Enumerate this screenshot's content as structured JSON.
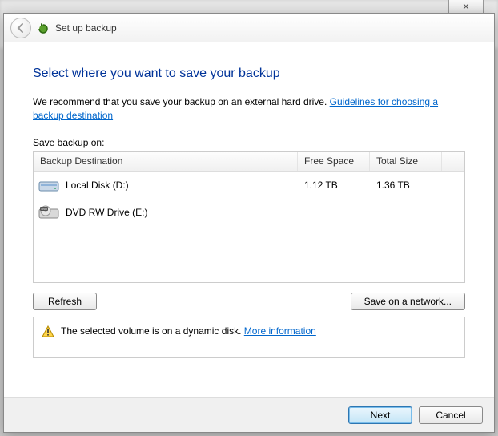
{
  "backdrop_close": "✕",
  "titlebar": {
    "back_aria": "Back",
    "title": "Set up backup"
  },
  "main": {
    "heading": "Select where you want to save your backup",
    "recommend_pre": "We recommend that you save your backup on an external hard drive. ",
    "recommend_link": "Guidelines for choosing a backup destination",
    "save_label": "Save backup on:"
  },
  "drive_table": {
    "columns": {
      "destination": "Backup Destination",
      "free": "Free Space",
      "total": "Total Size"
    },
    "rows": [
      {
        "name": "Local Disk (D:)",
        "free": "1.12 TB",
        "total": "1.36 TB",
        "icon": "hdd"
      },
      {
        "name": "DVD RW Drive (E:)",
        "free": "",
        "total": "",
        "icon": "dvd"
      }
    ]
  },
  "buttons": {
    "refresh": "Refresh",
    "save_network": "Save on a network...",
    "next": "Next",
    "cancel": "Cancel"
  },
  "info": {
    "text": "The selected volume is on a dynamic disk. ",
    "link": "More information"
  }
}
